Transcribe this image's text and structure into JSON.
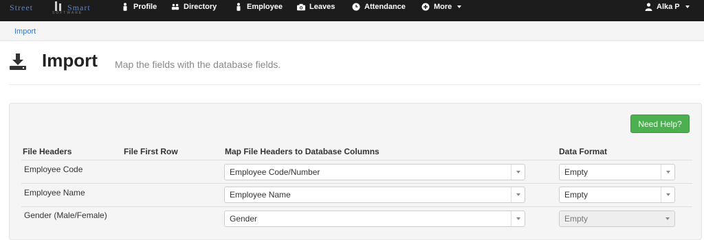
{
  "logo": {
    "text_left": "Street",
    "text_right": "Smart",
    "subtext": "SOFTWARE"
  },
  "nav": {
    "items": [
      {
        "label": "Profile",
        "icon": "person-icon"
      },
      {
        "label": "Directory",
        "icon": "people-icon"
      },
      {
        "label": "Employee",
        "icon": "person-icon"
      },
      {
        "label": "Leaves",
        "icon": "camera-icon"
      },
      {
        "label": "Attendance",
        "icon": "clock-icon"
      },
      {
        "label": "More",
        "icon": "plus-circle-icon"
      }
    ],
    "user": "Alka P"
  },
  "breadcrumb": {
    "current": "Import"
  },
  "page": {
    "title": "Import",
    "subtitle": "Map the fields with the database fields."
  },
  "help_button": "Need Help?",
  "table": {
    "headers": [
      "File Headers",
      "File First Row",
      "Map File Headers to Database Columns",
      "Data Format"
    ],
    "rows": [
      {
        "file_header": "Employee Code",
        "first_row": "",
        "mapped_column": "Employee Code/Number",
        "data_format": "Empty"
      },
      {
        "file_header": "Employee Name",
        "first_row": "",
        "mapped_column": "Employee Name",
        "data_format": "Empty"
      },
      {
        "file_header": "Gender (Male/Female)",
        "first_row": "",
        "mapped_column": "Gender",
        "data_format": "Empty"
      }
    ]
  },
  "colors": {
    "nav_bg": "#1c1c1c",
    "link": "#3a74c1",
    "help_button": "#4caf50"
  }
}
